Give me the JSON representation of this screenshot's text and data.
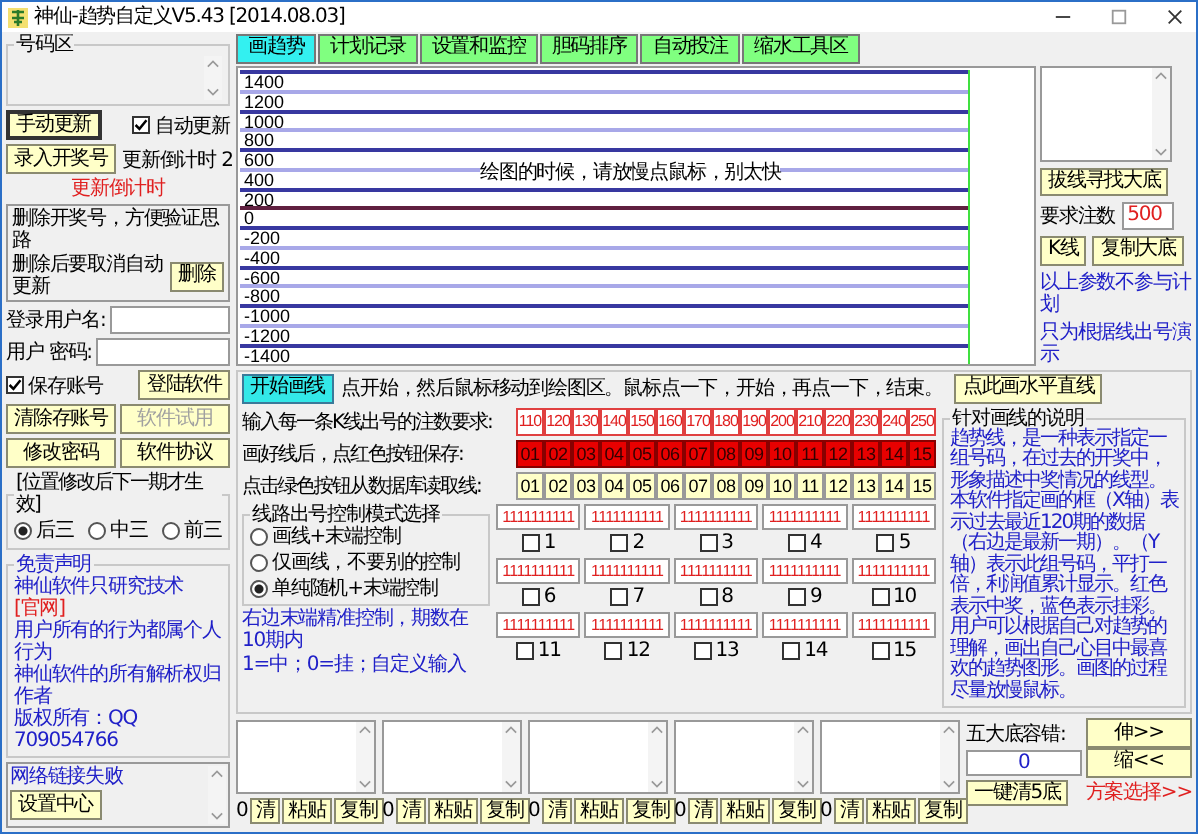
{
  "window": {
    "title": "神仙-趋势自定义V5.43 [2014.08.03]"
  },
  "sidebar": {
    "number_area": {
      "title": "号码区"
    },
    "manual_update_button": "手动更新",
    "auto_update": {
      "label": "自动更新",
      "checked": true
    },
    "enter_draw_button": "录入开奖号",
    "countdown": "更新倒计时 2",
    "countdown_notice": "更新倒计时",
    "delete_notes": [
      "删除开奖号，方便验证思路",
      "删除后要取消自动更新"
    ],
    "delete_button": "删除",
    "username": {
      "label": "登录用户名:"
    },
    "password": {
      "label": "用户 密码:"
    },
    "save_account": {
      "label": "保存账号",
      "checked": true
    },
    "login_button": "登陆软件",
    "buttons": [
      {
        "label": "清除存账号",
        "disabled": false
      },
      {
        "label": "软件试用",
        "disabled": true
      },
      {
        "label": "修改密码",
        "disabled": false
      },
      {
        "label": "软件协议",
        "disabled": false
      }
    ],
    "position": {
      "title": "[位置修改后下一期才生效]",
      "options": [
        {
          "label": "后三",
          "selected": true
        },
        {
          "label": "中三",
          "selected": false
        },
        {
          "label": "前三",
          "selected": false
        }
      ]
    },
    "disclaimer": {
      "title": "免责声明",
      "lines": [
        {
          "text": "神仙软件只研究技术",
          "link": "[官网]"
        },
        {
          "text": "用户所有的行为都属个人行为"
        },
        {
          "text": "神仙软件的所有解析权归作者"
        },
        {
          "text": "版权所有：QQ 709054766"
        }
      ]
    },
    "log": {
      "text": "网络链接失败"
    },
    "settings_button": "设置中心"
  },
  "tabs": [
    {
      "label": "画趋势",
      "selected": true
    },
    {
      "label": "计划记录",
      "selected": false
    },
    {
      "label": "设置和监控",
      "selected": false
    },
    {
      "label": "胆码排序",
      "selected": false
    },
    {
      "label": "自动投注",
      "selected": false
    },
    {
      "label": "缩水工具区",
      "selected": false
    }
  ],
  "chart": {
    "y_labels": [
      {
        "text": "1400",
        "baseline": false
      },
      {
        "text": "1200",
        "baseline": false
      },
      {
        "text": "1000",
        "baseline": false
      },
      {
        "text": "800",
        "baseline": false
      },
      {
        "text": "600",
        "baseline": false
      },
      {
        "text": "400",
        "baseline": false
      },
      {
        "text": "200",
        "baseline": false
      },
      {
        "text": "0",
        "baseline": true
      },
      {
        "text": "-200",
        "baseline": false
      },
      {
        "text": "-400",
        "baseline": false
      },
      {
        "text": "-600",
        "baseline": false
      },
      {
        "text": "-800",
        "baseline": false
      },
      {
        "text": "-1000",
        "baseline": false
      },
      {
        "text": "-1200",
        "baseline": false
      },
      {
        "text": "-1400",
        "baseline": false
      }
    ],
    "message": "绘图的时候，请放慢点鼠标，别太快"
  },
  "right_panel": {
    "find_button": "拔线寻找大底",
    "required_count": {
      "label": "要求注数",
      "value": "500"
    },
    "kline_button": "K线",
    "copy_button": "复制大底",
    "note": [
      "以上参数不参与计划",
      "只为根据线出号演示"
    ]
  },
  "drawing": {
    "start_button": "开始画线",
    "instruction": "点开始，然后鼠标移动到绘图区。鼠标点一下，开始，再点一下，结束。",
    "horizontal_button": "点此画水平直线",
    "line_rows": [
      {
        "kind": "count",
        "label": "输入每一条K线出号的注数要求:",
        "items": [
          "110",
          "120",
          "130",
          "140",
          "150",
          "160",
          "170",
          "180",
          "190",
          "200",
          "210",
          "220",
          "230",
          "240",
          "250"
        ]
      },
      {
        "kind": "save",
        "label": "画好线后，点红色按钮保存:",
        "items": [
          "01",
          "02",
          "03",
          "04",
          "05",
          "06",
          "07",
          "08",
          "09",
          "10",
          "11",
          "12",
          "13",
          "14",
          "15"
        ]
      },
      {
        "kind": "load",
        "label": "点击绿色按钮从数据库读取线:",
        "items": [
          "01",
          "02",
          "03",
          "04",
          "05",
          "06",
          "07",
          "08",
          "09",
          "10",
          "11",
          "12",
          "13",
          "14",
          "15"
        ]
      }
    ],
    "mode": {
      "title": "线路出号控制模式选择",
      "options": [
        {
          "label": "画线+末端控制",
          "selected": false
        },
        {
          "label": "仅画线，不要别的控制",
          "selected": false
        },
        {
          "label": "单纯随机+末端控制",
          "selected": true
        }
      ]
    },
    "mode_note": [
      "右边末端精准控制，期数在10期内",
      "1=中；0=挂；自定义输入"
    ],
    "end_controls": [
      {
        "value": "1111111111",
        "label": "1",
        "checked": false
      },
      {
        "value": "1111111111",
        "label": "2",
        "checked": false
      },
      {
        "value": "1111111111",
        "label": "3",
        "checked": false
      },
      {
        "value": "1111111111",
        "label": "4",
        "checked": false
      },
      {
        "value": "1111111111",
        "label": "5",
        "checked": false
      },
      {
        "value": "1111111111",
        "label": "6",
        "checked": false
      },
      {
        "value": "1111111111",
        "label": "7",
        "checked": false
      },
      {
        "value": "1111111111",
        "label": "8",
        "checked": false
      },
      {
        "value": "1111111111",
        "label": "9",
        "checked": false
      },
      {
        "value": "1111111111",
        "label": "10",
        "checked": false
      },
      {
        "value": "1111111111",
        "label": "11",
        "checked": false
      },
      {
        "value": "1111111111",
        "label": "12",
        "checked": false
      },
      {
        "value": "1111111111",
        "label": "13",
        "checked": false
      },
      {
        "value": "1111111111",
        "label": "14",
        "checked": false
      },
      {
        "value": "1111111111",
        "label": "15",
        "checked": false
      }
    ],
    "explanation": {
      "title": "针对画线的说明",
      "text": "趋势线，是一种表示指定一组号码，在过去的开奖中，形象描述中奖情况的线型。本软件指定画的框（X轴）表示过去最近120期的数据（右边是最新一期）。（Y轴）表示此组号码，平打一倍，利润值累计显示。红色表示中奖，蓝色表示挂彩。用户可以根据自己对趋势的理解，画出自己心目中最喜欢的趋势图形。画图的过程尽量放慢鼠标。"
    }
  },
  "bottom": {
    "boxes": [
      {
        "count": "0",
        "buttons": [
          "清",
          "粘贴",
          "复制"
        ]
      },
      {
        "count": "0",
        "buttons": [
          "清",
          "粘贴",
          "复制"
        ]
      },
      {
        "count": "0",
        "buttons": [
          "清",
          "粘贴",
          "复制"
        ]
      },
      {
        "count": "0",
        "buttons": [
          "清",
          "粘贴",
          "复制"
        ]
      },
      {
        "count": "0",
        "buttons": [
          "清",
          "粘贴",
          "复制"
        ]
      }
    ],
    "tolerance": {
      "label": "五大底容错:",
      "value": "0"
    },
    "clear_all_button": "一键清5底",
    "expand_button": "伸>>",
    "shrink_button": "缩<<",
    "scheme_link": "方案选择>>"
  }
}
